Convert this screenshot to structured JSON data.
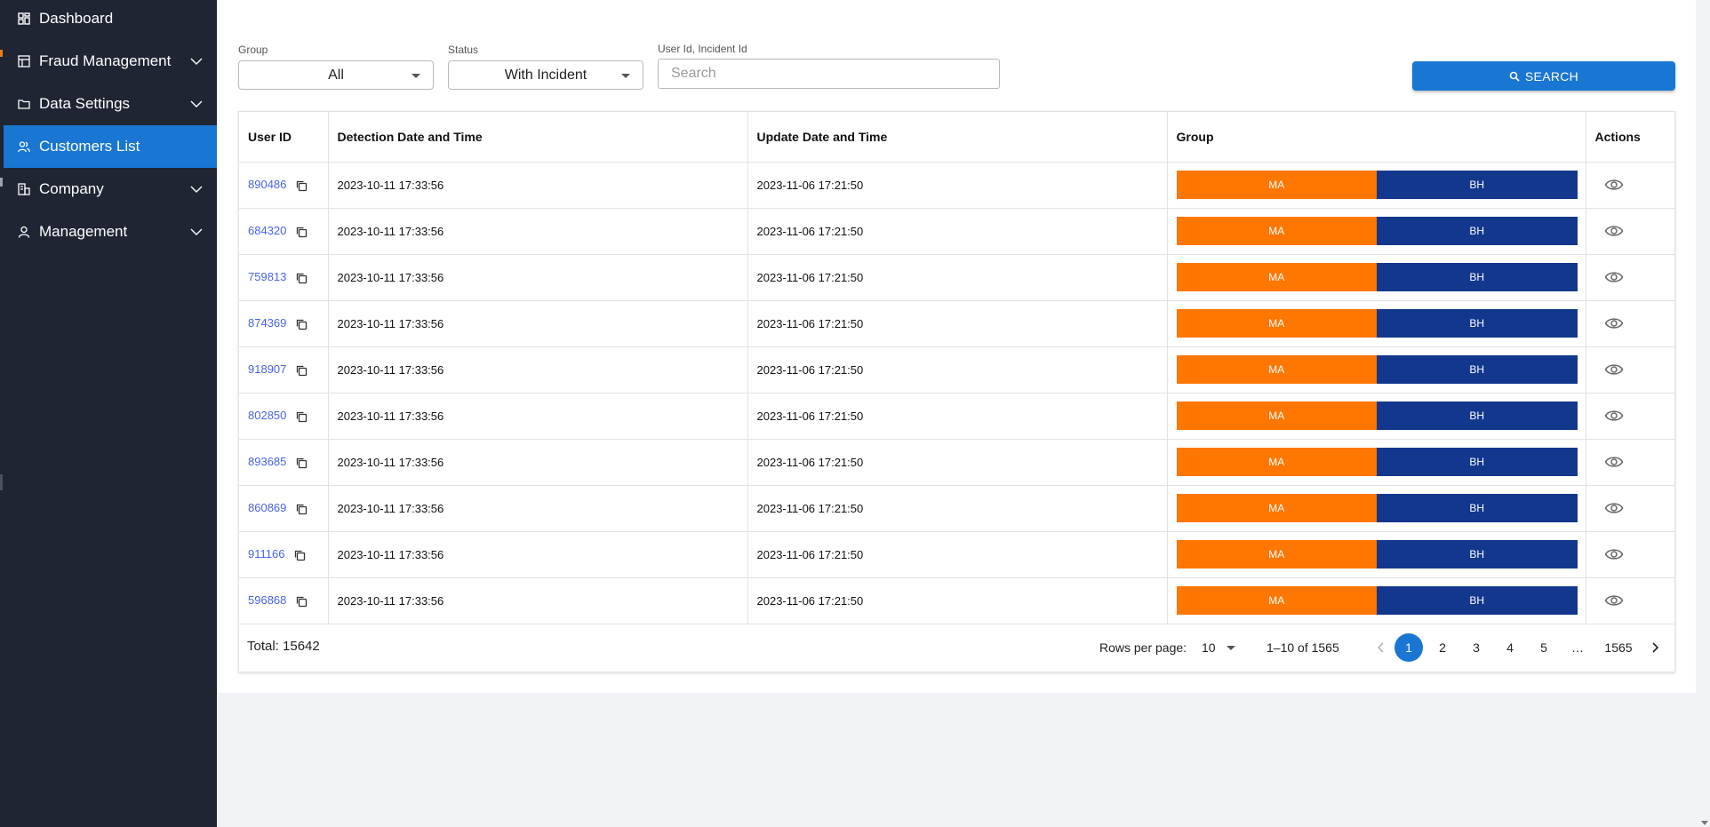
{
  "sidebar": {
    "items": [
      {
        "label": "Dashboard",
        "icon": "dashboard-icon",
        "expandable": false,
        "active": false
      },
      {
        "label": "Fraud Management",
        "icon": "fraud-icon",
        "expandable": true,
        "active": false
      },
      {
        "label": "Data Settings",
        "icon": "folder-icon",
        "expandable": true,
        "active": false
      },
      {
        "label": "Customers List",
        "icon": "people-icon",
        "expandable": false,
        "active": true
      },
      {
        "label": "Company",
        "icon": "building-icon",
        "expandable": true,
        "active": false
      },
      {
        "label": "Management",
        "icon": "person-icon",
        "expandable": true,
        "active": false
      }
    ]
  },
  "filters": {
    "group": {
      "label": "Group",
      "value": "All"
    },
    "status": {
      "label": "Status",
      "value": "With Incident"
    },
    "query": {
      "label": "User Id, Incident Id",
      "placeholder": "Search",
      "value": ""
    },
    "search_button": "SEARCH"
  },
  "table": {
    "columns": [
      "User ID",
      "Detection Date and Time",
      "Update Date and Time",
      "Group",
      "Actions"
    ],
    "rows": [
      {
        "user_id": "890486",
        "detected": "2023-10-11 17:33:56",
        "updated": "2023-11-06 17:21:50",
        "groups": [
          "MA",
          "BH"
        ]
      },
      {
        "user_id": "684320",
        "detected": "2023-10-11 17:33:56",
        "updated": "2023-11-06 17:21:50",
        "groups": [
          "MA",
          "BH"
        ]
      },
      {
        "user_id": "759813",
        "detected": "2023-10-11 17:33:56",
        "updated": "2023-11-06 17:21:50",
        "groups": [
          "MA",
          "BH"
        ]
      },
      {
        "user_id": "874369",
        "detected": "2023-10-11 17:33:56",
        "updated": "2023-11-06 17:21:50",
        "groups": [
          "MA",
          "BH"
        ]
      },
      {
        "user_id": "918907",
        "detected": "2023-10-11 17:33:56",
        "updated": "2023-11-06 17:21:50",
        "groups": [
          "MA",
          "BH"
        ]
      },
      {
        "user_id": "802850",
        "detected": "2023-10-11 17:33:56",
        "updated": "2023-11-06 17:21:50",
        "groups": [
          "MA",
          "BH"
        ]
      },
      {
        "user_id": "893685",
        "detected": "2023-10-11 17:33:56",
        "updated": "2023-11-06 17:21:50",
        "groups": [
          "MA",
          "BH"
        ]
      },
      {
        "user_id": "860869",
        "detected": "2023-10-11 17:33:56",
        "updated": "2023-11-06 17:21:50",
        "groups": [
          "MA",
          "BH"
        ]
      },
      {
        "user_id": "911166",
        "detected": "2023-10-11 17:33:56",
        "updated": "2023-11-06 17:21:50",
        "groups": [
          "MA",
          "BH"
        ]
      },
      {
        "user_id": "596868",
        "detected": "2023-10-11 17:33:56",
        "updated": "2023-11-06 17:21:50",
        "groups": [
          "MA",
          "BH"
        ]
      }
    ]
  },
  "footer": {
    "total_label": "Total: 15642",
    "rows_per_page_label": "Rows per page:",
    "rows_per_page": "10",
    "range": "1–10 of 1565",
    "pages": [
      "1",
      "2",
      "3",
      "4",
      "5",
      "…",
      "1565"
    ],
    "current_page": "1"
  },
  "colors": {
    "sidebar_bg": "#1f2533",
    "accent": "#1976d2",
    "group_ma": "#ff7600",
    "group_bh": "#12378d",
    "link": "#4a63e7"
  }
}
